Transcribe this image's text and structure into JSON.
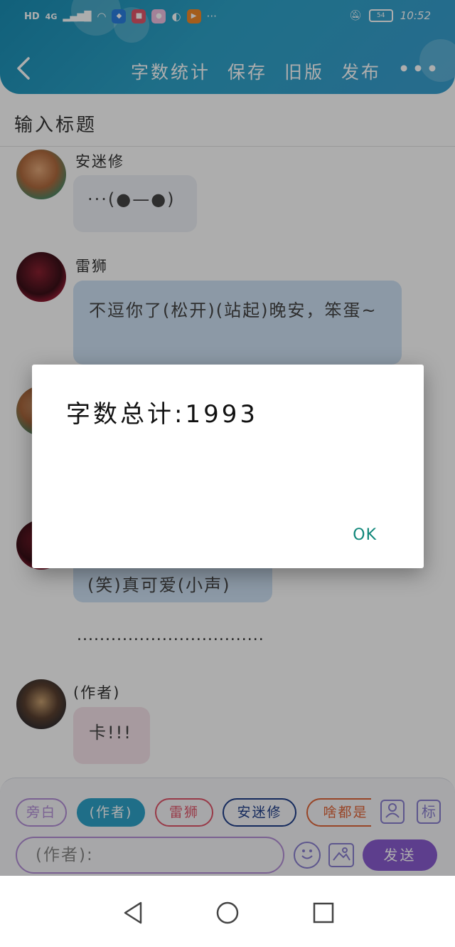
{
  "status_bar": {
    "left_labels": [
      "HD",
      "4G"
    ],
    "time": "10:52",
    "battery": "54"
  },
  "header": {
    "back_icon": "chevron-left-icon",
    "actions": [
      "字数统计",
      "保存",
      "旧版",
      "发布"
    ],
    "more_icon": "more-horizontal-icon",
    "more_label": "•••"
  },
  "title_input": {
    "placeholder": "输入标题"
  },
  "messages": [
    {
      "sender": "安迷修",
      "text": "···(●—●)"
    },
    {
      "sender": "雷狮",
      "text": "不逗你了(松开)(站起)晚安，笨蛋~"
    },
    {
      "sender": "",
      "text": ""
    },
    {
      "sender": "",
      "text": "(笑)真可爱(小声)"
    },
    {
      "sender": "(作者)",
      "text": "卡!!!"
    }
  ],
  "divider_text": ".................................",
  "roles": [
    "旁白",
    "(作者)",
    "雷狮",
    "安迷修",
    "啥都是"
  ],
  "composer": {
    "input_value": "(作者):",
    "send_label": "发送",
    "role_icon": "user-card-icon",
    "tag_label": "标",
    "emoji_icon": "emoji-icon",
    "image_icon": "image-icon"
  },
  "dialog": {
    "message": "字数总计:1993",
    "ok_label": "OK"
  },
  "colors": {
    "header": "#2ea3c9",
    "bubble_blue": "#cfe2f5",
    "bubble_gray": "#eef0f6",
    "bubble_pink": "#f6e3ea",
    "send": "#8a5cd0",
    "ok": "#10877a"
  }
}
